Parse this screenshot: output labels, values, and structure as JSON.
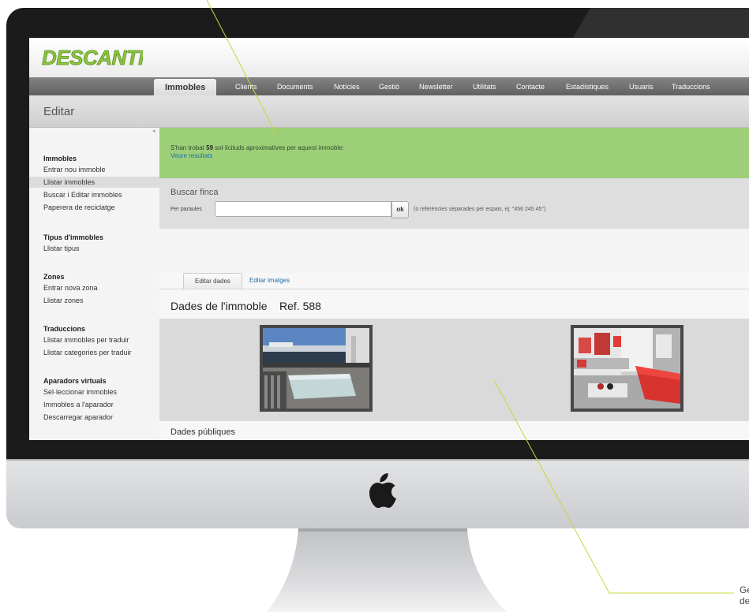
{
  "app": {
    "logo_text": "DESCANTIA",
    "page_title": "Editar"
  },
  "nav": {
    "tabs": [
      "Immobles",
      "Clients",
      "Documents",
      "Notícies",
      "Gestió",
      "Newsletter",
      "Utilitats",
      "Contacte",
      "Estadístiques",
      "Usuaris",
      "Traduccions"
    ],
    "active_index": 0
  },
  "sidebar": {
    "collapse_glyph": "◂",
    "sections": [
      {
        "heading": "Immobles",
        "items": [
          "Entrar nou immoble",
          "Llistar immobles",
          "Buscar i Editar immobles",
          "Paperera de reciclatge"
        ],
        "active_item": "Llistar immobles"
      },
      {
        "heading": "Tipus d'immobles",
        "items": [
          "Llistar tipus"
        ]
      },
      {
        "heading": "Zones",
        "items": [
          "Entrar nova zona",
          "Llistar zones"
        ]
      },
      {
        "heading": "Traduccions",
        "items": [
          "Llistar immobles per traduir",
          "Llistar categories per traduir"
        ]
      },
      {
        "heading": "Aparadors virtuals",
        "items": [
          "Sel·leccionar immobles",
          "Immobles a l'aparador",
          "Descarregar aparador"
        ]
      }
    ]
  },
  "alert": {
    "prefix": "S'han trobat ",
    "count": "59",
    "suffix": " sol·licituds aproximatives per aquest immoble:",
    "link": "Veure resultats"
  },
  "search": {
    "title": "Buscar finca",
    "label": "Per paraules",
    "value": "",
    "button": "ok",
    "hint": "(o referències separades per espais, ej: \"456 245 45\")"
  },
  "tabs": {
    "edit_data": "Editar dades",
    "edit_images": "Editar imatges"
  },
  "property": {
    "title": "Dades de l'immoble",
    "ref": "Ref. 588"
  },
  "public_section": "Dades públiques",
  "callout": {
    "text_line1": "Ge",
    "text_line2": "de"
  },
  "colors": {
    "brand_green": "#8cc63f",
    "alert_green": "#9dcf78",
    "link_blue": "#1e6fa8"
  }
}
